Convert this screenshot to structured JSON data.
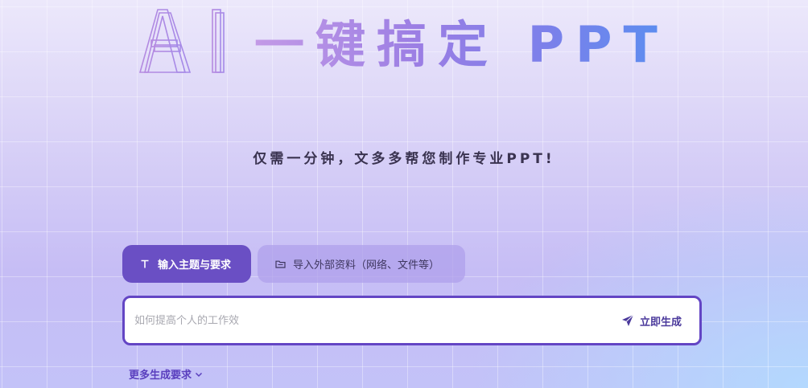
{
  "hero": {
    "logo_text": "AI",
    "title": "一键搞定 PPT"
  },
  "subtitle": "仅需一分钟，文多多帮您制作专业PPT!",
  "tabs": [
    {
      "label": "输入主题与要求",
      "icon": "text-icon",
      "active": true
    },
    {
      "label": "导入外部资料（网络、文件等）",
      "icon": "folder-icon",
      "active": false
    }
  ],
  "input": {
    "placeholder": "如何提高个人的工作效",
    "value": ""
  },
  "generate_button": {
    "label": "立即生成",
    "icon": "send-icon"
  },
  "more_options": {
    "label": "更多生成要求",
    "icon": "chevron-down-icon"
  },
  "colors": {
    "accent": "#6a4fc4",
    "border": "#6345c4",
    "link": "#5a3fbe"
  }
}
